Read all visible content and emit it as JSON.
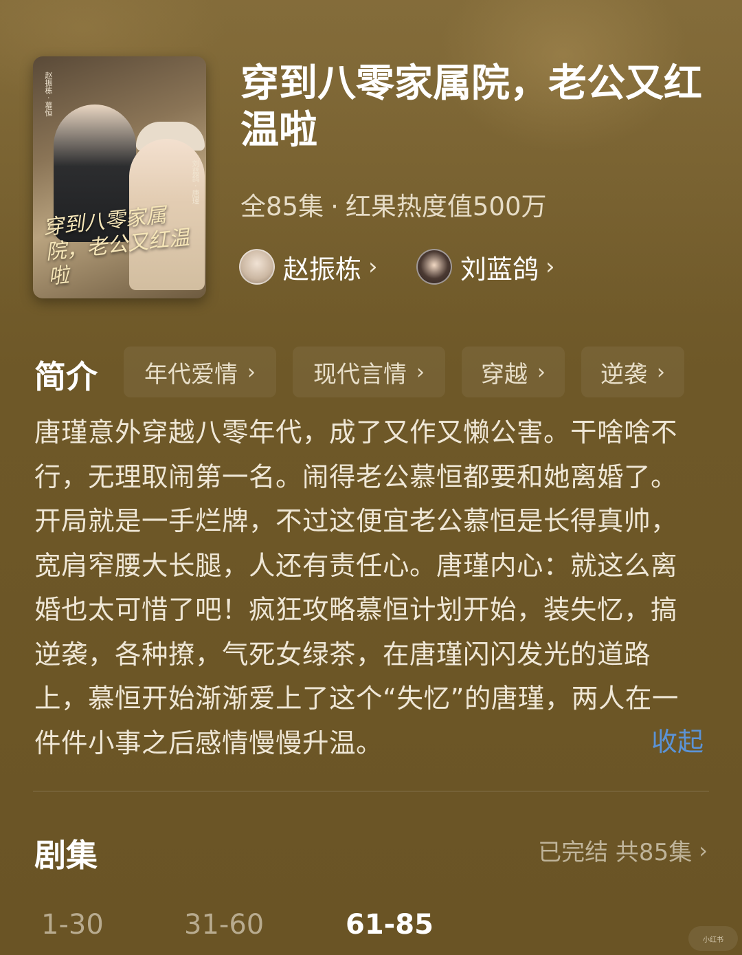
{
  "show": {
    "poster_title": "穿到八零家属院，老公又红温啦",
    "poster_credits_left": "赵振栋 · 慕恒",
    "poster_credits_right": "刘蓝鸽 · 唐瑾",
    "title": "穿到八零家属院，老公又红温啦",
    "episodes_total": "全85集",
    "separator": "·",
    "heat": "红果热度值500万"
  },
  "actors": [
    {
      "name": "赵振栋",
      "chevron": "›"
    },
    {
      "name": "刘蓝鸽",
      "chevron": "›"
    }
  ],
  "intro": {
    "heading": "简介",
    "tags": [
      {
        "label": "年代爱情",
        "chevron": "›"
      },
      {
        "label": "现代言情",
        "chevron": "›"
      },
      {
        "label": "穿越",
        "chevron": "›"
      },
      {
        "label": "逆袭",
        "chevron": "›"
      }
    ],
    "description": "唐瑾意外穿越八零年代，成了又作又懒公害。干啥啥不行，无理取闹第一名。闹得老公慕恒都要和她离婚了。开局就是一手烂牌，不过这便宜老公慕恒是长得真帅，宽肩窄腰大长腿，人还有责任心。唐瑾内心：就这么离婚也太可惜了吧！疯狂攻略慕恒计划开始，装失忆，搞逆袭，各种撩，气死女绿茶，在唐瑾闪闪发光的道路上，慕恒开始渐渐爱上了这个“失忆”的唐瑾，两人在一件件小事之后感情慢慢升温。",
    "collapse_label": "收起"
  },
  "episodes": {
    "heading": "剧集",
    "status": "已完结 共85集",
    "chevron": "›",
    "ranges": [
      "1-30",
      "31-60",
      "61-85"
    ],
    "selected_range": "61-85"
  },
  "watermark": "小红书",
  "colors": {
    "background": "#6e5828",
    "link": "#5b93d6",
    "muted": "#bfb49a"
  }
}
